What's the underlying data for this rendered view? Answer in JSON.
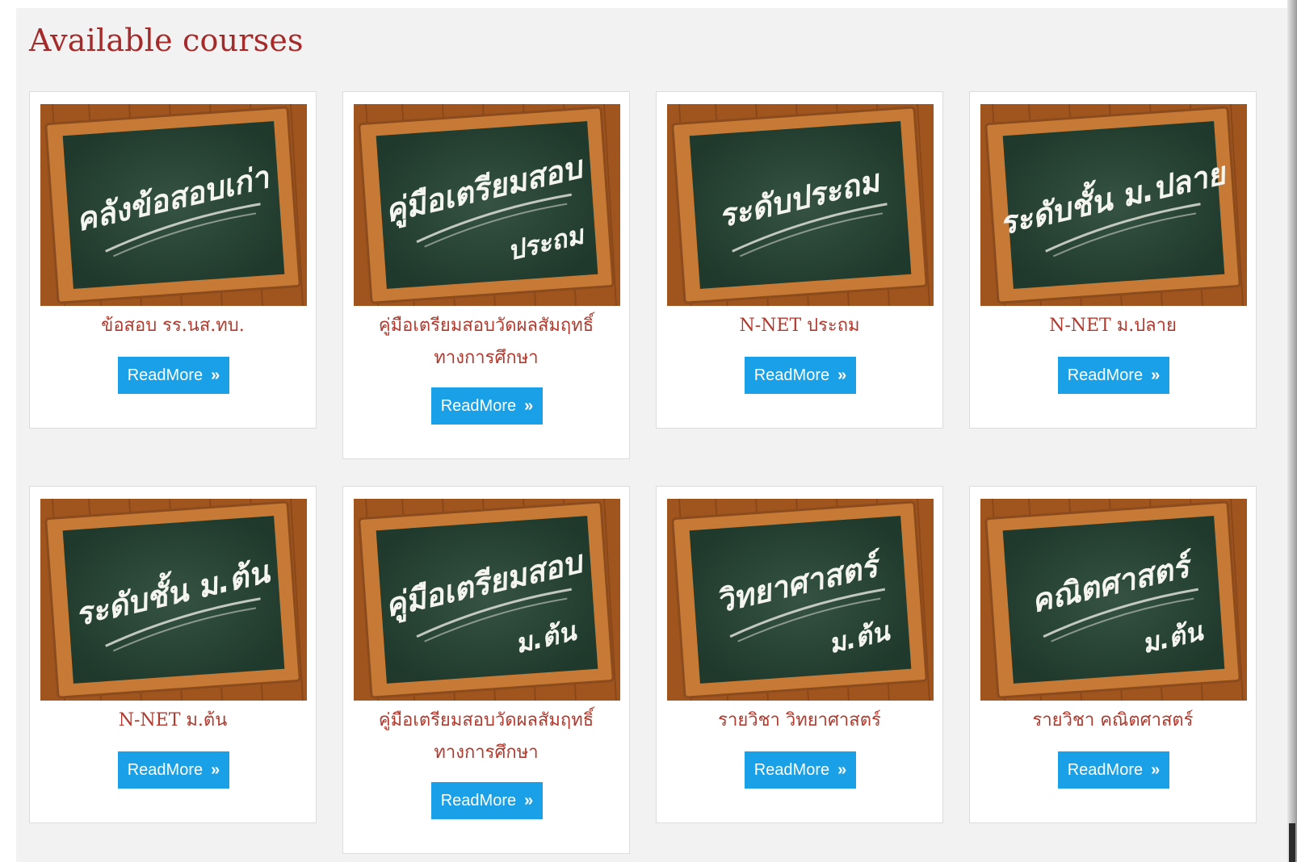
{
  "page": {
    "title": "Available courses"
  },
  "read_more_label": "ReadMore",
  "read_more_icon": "double-chevron-right-icon",
  "colors": {
    "title": "#a52a2a",
    "course_name": "#b03a2e",
    "button": "#1aa0e6",
    "board": "#1f3a2c",
    "frame": "#b8682b"
  },
  "courses": [
    {
      "name": "ข้อสอบ รร.นส.ทบ.",
      "board_text": "คลังข้อสอบเก่า",
      "board_sub": ""
    },
    {
      "name": "คู่มือเตรียมสอบวัดผลสัมฤทธิ์ทางการศึกษา",
      "board_text": "คู่มือเตรียมสอบ",
      "board_sub": "ประถม"
    },
    {
      "name": "N-NET ประถม",
      "board_text": "ระดับประถม",
      "board_sub": ""
    },
    {
      "name": "N-NET ม.ปลาย",
      "board_text": "ระดับชั้น ม.ปลาย",
      "board_sub": ""
    },
    {
      "name": "N-NET ม.ต้น",
      "board_text": "ระดับชั้น ม.ต้น",
      "board_sub": ""
    },
    {
      "name": "คู่มือเตรียมสอบวัดผลสัมฤทธิ์ทางการศึกษา",
      "board_text": "คู่มือเตรียมสอบ",
      "board_sub": "ม.ต้น"
    },
    {
      "name": "รายวิชา วิทยาศาสตร์",
      "board_text": "วิทยาศาสตร์",
      "board_sub": "ม.ต้น"
    },
    {
      "name": "รายวิชา คณิตศาสตร์",
      "board_text": "คณิตศาสตร์",
      "board_sub": "ม.ต้น"
    }
  ]
}
